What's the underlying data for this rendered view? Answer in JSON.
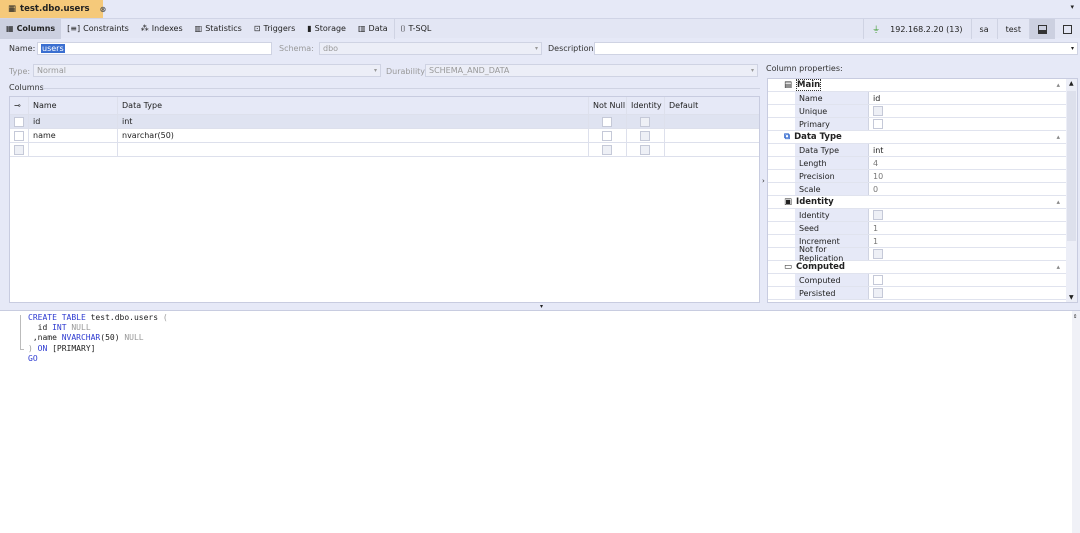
{
  "tab": {
    "title": "test.dbo.users",
    "close": "⊗"
  },
  "toolbar": {
    "items": [
      {
        "icon": "grid-icon",
        "label": "Columns"
      },
      {
        "icon": "constraints-icon",
        "label": "Constraints"
      },
      {
        "icon": "indexes-icon",
        "label": "Indexes"
      },
      {
        "icon": "statistics-icon",
        "label": "Statistics"
      },
      {
        "icon": "triggers-icon",
        "label": "Triggers"
      },
      {
        "icon": "storage-icon",
        "label": "Storage"
      },
      {
        "icon": "data-icon",
        "label": "Data"
      },
      {
        "icon": "tsql-icon",
        "label": "T-SQL"
      }
    ],
    "server": "192.168.2.20 (13)",
    "user": "sa",
    "database": "test"
  },
  "form": {
    "name_label": "Name:",
    "name_value": "users",
    "schema_label": "Schema:",
    "schema_value": "dbo",
    "description_label": "Description:",
    "description_value": "",
    "type_label": "Type:",
    "type_value": "Normal",
    "durability_label": "Durability:",
    "durability_value": "SCHEMA_AND_DATA",
    "columns_label": "Columns"
  },
  "grid": {
    "headers": [
      "Name",
      "Data Type",
      "Not Null",
      "Identity",
      "Default"
    ],
    "rows": [
      {
        "name": "id",
        "type": "int"
      },
      {
        "name": "name",
        "type": "nvarchar(50)"
      }
    ]
  },
  "props": {
    "title": "Column properties:",
    "main": {
      "label": "Main",
      "name_l": "Name",
      "name_v": "id",
      "unique_l": "Unique",
      "primary_l": "Primary"
    },
    "datatype": {
      "label": "Data Type",
      "type_l": "Data Type",
      "type_v": "int",
      "length_l": "Length",
      "length_v": "4",
      "precision_l": "Precision",
      "precision_v": "10",
      "scale_l": "Scale",
      "scale_v": "0"
    },
    "identity": {
      "label": "Identity",
      "identity_l": "Identity",
      "seed_l": "Seed",
      "seed_v": "1",
      "inc_l": "Increment",
      "inc_v": "1",
      "nfr_l": "Not for Replication"
    },
    "computed": {
      "label": "Computed",
      "computed_l": "Computed",
      "persisted_l": "Persisted"
    }
  },
  "sql": {
    "l1a": "CREATE TABLE",
    "l1b": " test.dbo.users ",
    "l1c": "(",
    "l2a": "  id ",
    "l2b": "INT",
    "l2c": " NULL",
    "l3a": " ,name ",
    "l3b": "NVARCHAR",
    "l3c": "(50)",
    "l3d": " NULL",
    "l4a": ") ",
    "l4b": "ON",
    "l4c": " [PRIMARY]",
    "l5": "GO"
  }
}
